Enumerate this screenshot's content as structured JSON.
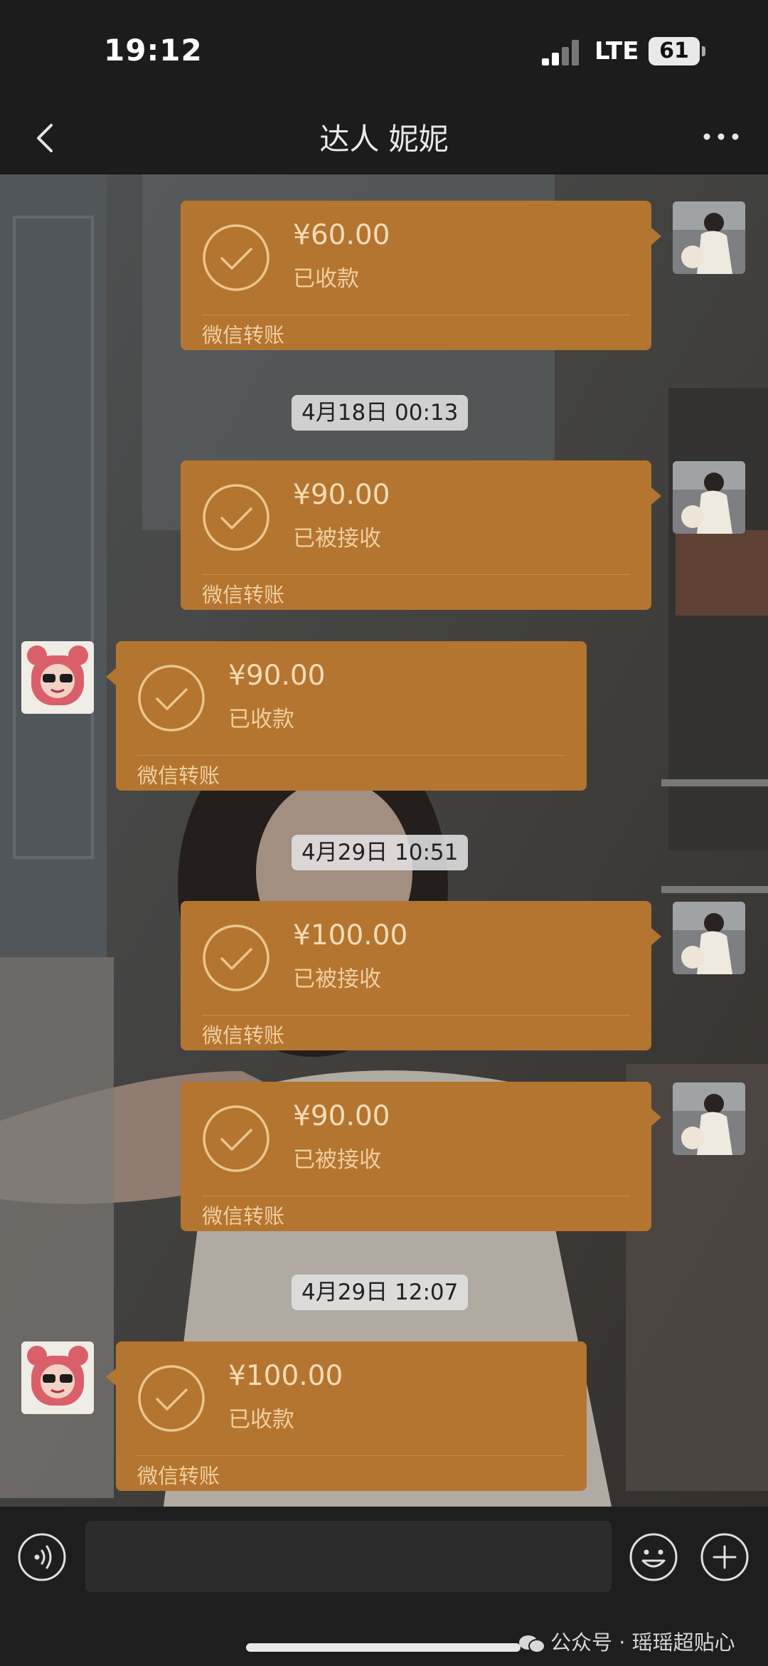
{
  "status_bar": {
    "time": "19:12",
    "network": "LTE",
    "battery": "61"
  },
  "nav": {
    "title": "达人 妮妮",
    "back_icon": "chevron-left-icon",
    "more_icon": "more-dots-icon"
  },
  "messages": [
    {
      "side": "right",
      "amount": "¥60.00",
      "status": "已收款",
      "source": "微信转账"
    },
    {
      "side": "right",
      "amount": "¥90.00",
      "status": "已被接收",
      "source": "微信转账"
    },
    {
      "side": "left",
      "amount": "¥90.00",
      "status": "已收款",
      "source": "微信转账"
    },
    {
      "side": "right",
      "amount": "¥100.00",
      "status": "已被接收",
      "source": "微信转账"
    },
    {
      "side": "right",
      "amount": "¥90.00",
      "status": "已被接收",
      "source": "微信转账"
    },
    {
      "side": "left",
      "amount": "¥100.00",
      "status": "已收款",
      "source": "微信转账"
    }
  ],
  "timestamps": [
    "4月18日 00:13",
    "4月29日 10:51",
    "4月29日 12:07"
  ],
  "input_bar": {
    "voice_icon": "voice-icon",
    "emoji_icon": "emoji-icon",
    "plus_icon": "plus-icon"
  },
  "watermark": "公众号 · 瑶瑶超贴心",
  "colors": {
    "bubble": "#b47530",
    "bar": "#1c1c1c"
  }
}
